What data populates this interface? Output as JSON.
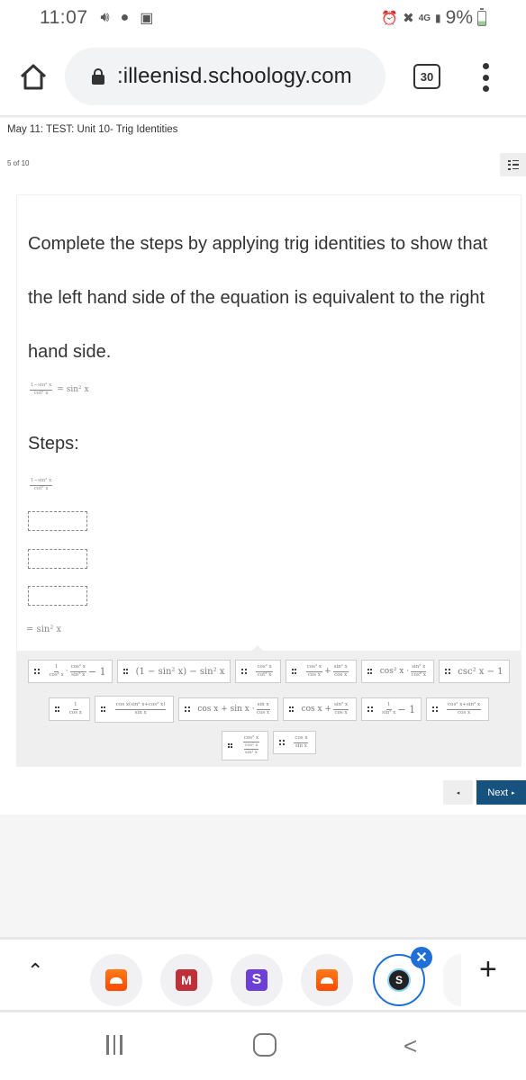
{
  "status_bar": {
    "time": "11:07",
    "left_icons": [
      "volume-icon",
      "snapchat-icon",
      "gallery-icon"
    ],
    "network": "4G",
    "battery_percent": "9%"
  },
  "browser": {
    "url": "killeenisd.schoology.com",
    "url_display": ":illeenisd.schoology.com",
    "tab_count": "30"
  },
  "page": {
    "title": "May 11: TEST: Unit 10- Trig Identities",
    "question_position": "5 of 10"
  },
  "question": {
    "prompt": "Complete the steps by applying trig identities to show that the left hand side of the equation is equivalent to the right hand side.",
    "equation": {
      "lhs_num": "1−sin² x",
      "lhs_den": "cot² x",
      "rhs": "= sin² x"
    },
    "steps_label": "Steps:",
    "step_start": {
      "num": "1−sin² x",
      "den": "cot² x"
    },
    "blank_steps": 3,
    "step_end": "= sin² x"
  },
  "tiles": [
    {
      "label": "1/cos² x · cos² x/sin² x − 1"
    },
    {
      "label": "(1 − sin² x) − sin² x"
    },
    {
      "label": "cos² x / cot² x"
    },
    {
      "label": "cos² x/cos x + sin² x/cos x"
    },
    {
      "label": "cos² x · sin² x/cos² x"
    },
    {
      "label": "csc² x − 1"
    },
    {
      "label": "1 / cos x"
    },
    {
      "label": "cos x(sin² x+cos² x) / sin x"
    },
    {
      "label": "cos x + sin x · sin x/cos x"
    },
    {
      "label": "cos x + sin² x/cos x"
    },
    {
      "label": "1/sin² x − 1"
    },
    {
      "label": "cos² x+sin² x / cos x"
    },
    {
      "label": "cos² x / (cos² x / sin² x)"
    },
    {
      "label": "cos x / sin x"
    }
  ],
  "tile_parts": {
    "t0": {
      "a_num": "1",
      "a_den": "cos² x",
      "b_num": "cos² x",
      "b_den": "sin² x",
      "tail": "− 1"
    },
    "t1": {
      "text": "(1 − sin² x) − sin² x"
    },
    "t2": {
      "num": "cos² x",
      "den": "cot² x"
    },
    "t3": {
      "a_num": "cos² x",
      "a_den": "cos x",
      "plus": "+",
      "b_num": "sin² x",
      "b_den": "cos x"
    },
    "t4": {
      "lead": "cos² x ·",
      "num": "sin² x",
      "den": "cos² x"
    },
    "t5": {
      "text": "csc² x − 1"
    },
    "t6": {
      "num": "1",
      "den": "cos x"
    },
    "t7": {
      "num": "cos x(sin² x+cos² x)",
      "den": "sin x"
    },
    "t8": {
      "lead": "cos x + sin x ·",
      "num": "sin x",
      "den": "cos x"
    },
    "t9": {
      "lead": "cos x +",
      "num": "sin² x",
      "den": "cos x"
    },
    "t10": {
      "num": "1",
      "den": "sin² x",
      "tail": "− 1"
    },
    "t11": {
      "num": "cos² x+sin² x",
      "den": "cos x"
    },
    "t12": {
      "num": "cos² x",
      "inner_num": "cos² x",
      "inner_den": "sin² x"
    },
    "t13": {
      "num": "cos x",
      "den": "sin x"
    }
  },
  "navigation": {
    "prev_label": "◂",
    "next_label": "Next",
    "next_arrow": "▸"
  },
  "colors": {
    "next_button": "#17527f",
    "active_tab_ring": "#1f6fd6",
    "tile_bank_bg": "#efefef"
  },
  "tab_strip": {
    "tabs": [
      {
        "icon": "soundcloud-icon"
      },
      {
        "icon": "mathway-icon",
        "glyph": "M"
      },
      {
        "icon": "s-app-icon",
        "glyph": "S"
      },
      {
        "icon": "soundcloud-icon"
      },
      {
        "icon": "schoology-icon",
        "glyph": "S",
        "active": true
      }
    ],
    "close_glyph": "✕",
    "new_tab_glyph": "+",
    "caret_glyph": "^"
  },
  "system_nav": {
    "back_glyph": "<"
  }
}
